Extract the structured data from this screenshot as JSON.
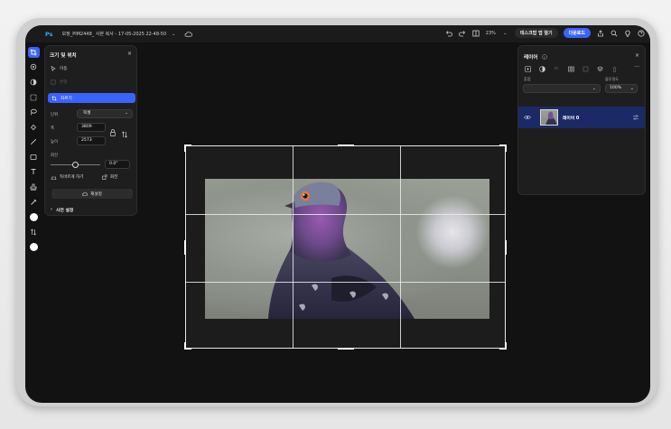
{
  "topbar": {
    "app_logo": "Ps",
    "document_title": "보정_PIM2448_ 사본 복사 - 17-05-2025 22-48-50",
    "zoom": "23%",
    "desktop_button": "데스크탑 앱 열기",
    "download_button": "다운로드"
  },
  "tools": [
    "crop-icon",
    "spot-heal-icon",
    "adjust-icon",
    "select-icon",
    "lasso-icon",
    "brush-fill-icon",
    "brush-icon",
    "shape-icon",
    "text-icon",
    "stamp-icon",
    "eyedropper-icon"
  ],
  "crop_panel": {
    "title": "크기 및 위치",
    "move_label": "이동",
    "transform_label": "변형",
    "crop_label": "자르기",
    "unit_label": "단위",
    "unit_value": "픽셀",
    "width_label": "폭",
    "width_value": "3809",
    "height_label": "높이",
    "height_value": "2573",
    "rotate_label": "회전",
    "rotate_value": "0.0°",
    "rotate_fraction": 0.5,
    "straighten_label": "똑바르게 하기",
    "rotate_button": "회전",
    "reset_label": "재설정",
    "presets_label": "사전 설정"
  },
  "layers_panel": {
    "title": "레이어",
    "blend_label": "혼합",
    "opacity_label": "불투명도",
    "opacity_value": "100%",
    "layer_name": "레이어 0"
  },
  "colors": {
    "accent": "#3b63fb",
    "photoshop_blue": "#31a8ff",
    "selected_layer": "#1b2a66",
    "background": "#121212"
  }
}
